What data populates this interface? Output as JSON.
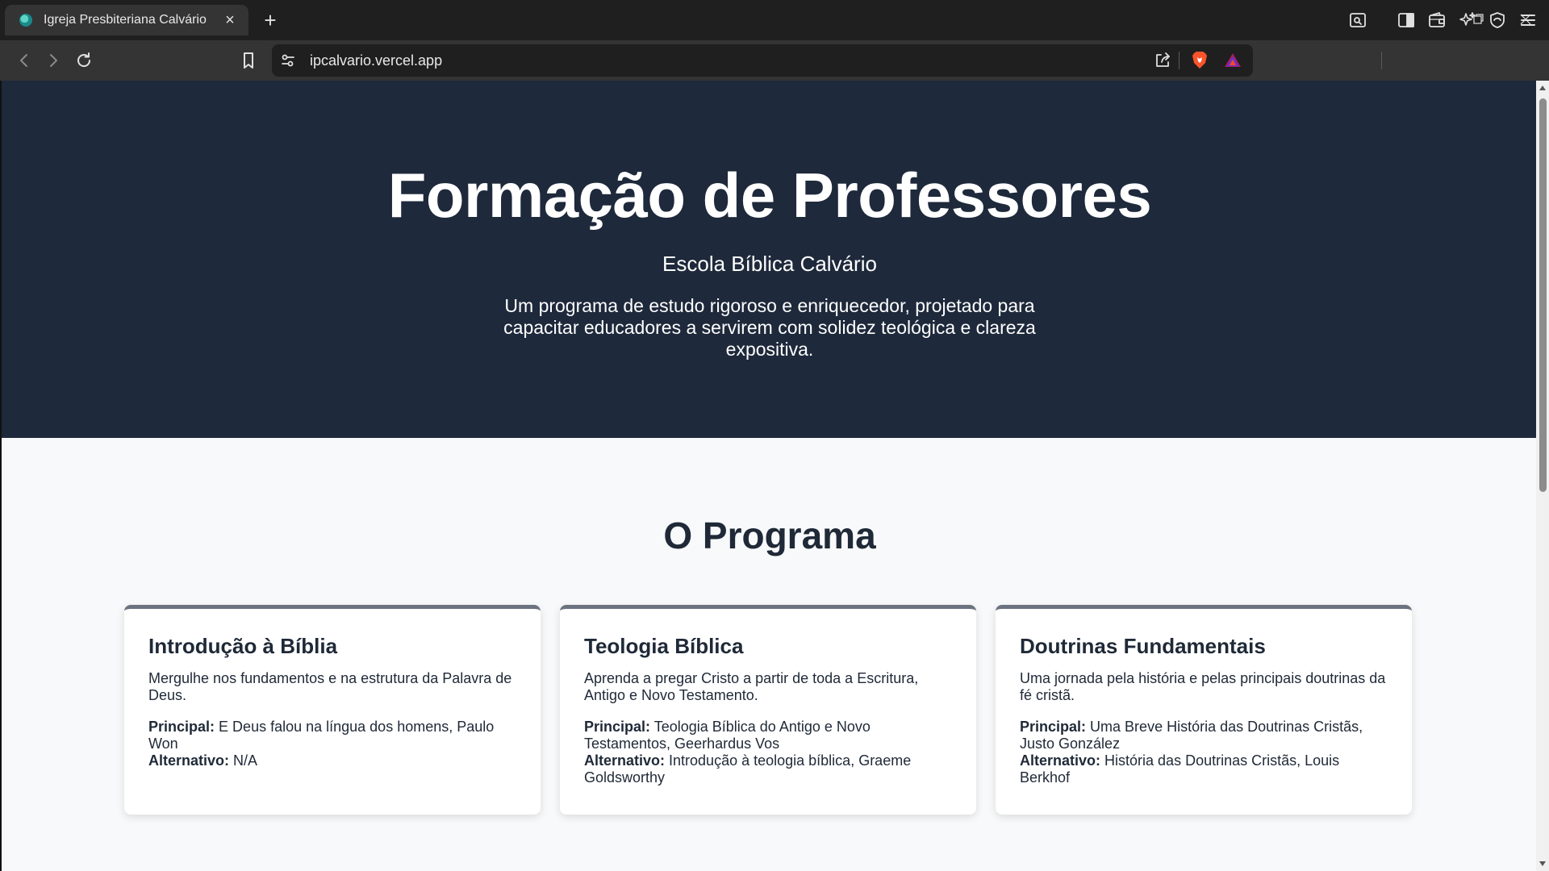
{
  "browser": {
    "tab_title": "Igreja Presbiteriana Calvário",
    "url": "ipcalvario.vercel.app",
    "icons": {
      "favicon": "globe-favicon",
      "close": "close-icon",
      "new_tab": "plus-icon",
      "back": "back-arrow-icon",
      "forward": "forward-arrow-icon",
      "reload": "reload-icon",
      "bookmark": "bookmark-icon",
      "site_settings": "tune-icon",
      "share": "share-icon",
      "brave_shields": "brave-lion-icon",
      "rewards": "brave-rewards-triangle-icon",
      "search_tab": "search-page-icon",
      "sidebar": "sidebar-icon",
      "wallet": "wallet-icon",
      "leo": "leo-sparkle-icon",
      "vpn": "vpn-shield-icon",
      "menu": "hamburger-menu-icon"
    }
  },
  "hero": {
    "title": "Formação de Professores",
    "subtitle": "Escola Bíblica Calvário",
    "description": "Um programa de estudo rigoroso e enriquecedor, projetado para capacitar educadores a servirem com solidez teológica e clareza expositiva."
  },
  "program": {
    "title": "O Programa",
    "principal_label": "Principal:",
    "alternativo_label": "Alternativo:",
    "cards": [
      {
        "title": "Introdução à Bíblia",
        "description": "Mergulhe nos fundamentos e na estrutura da Palavra de Deus.",
        "principal": "E Deus falou na língua dos homens, Paulo Won",
        "alternativo": "N/A"
      },
      {
        "title": "Teologia Bíblica",
        "description": "Aprenda a pregar Cristo a partir de toda a Escritura, Antigo e Novo Testamento.",
        "principal": "Teologia Bíblica do Antigo e Novo Testamentos, Geerhardus Vos",
        "alternativo": "Introdução à teologia bíblica, Graeme Goldsworthy"
      },
      {
        "title": "Doutrinas Fundamentais",
        "description": "Uma jornada pela história e pelas principais doutrinas da fé cristã.",
        "principal": "Uma Breve História das Doutrinas Cristãs, Justo González",
        "alternativo": "História das Doutrinas Cristãs, Louis Berkhof"
      }
    ]
  },
  "colors": {
    "hero_bg": "#1e293b",
    "page_bg": "#f8f9fa",
    "card_accent": "#6b7280",
    "text_dark": "#1f2937"
  }
}
